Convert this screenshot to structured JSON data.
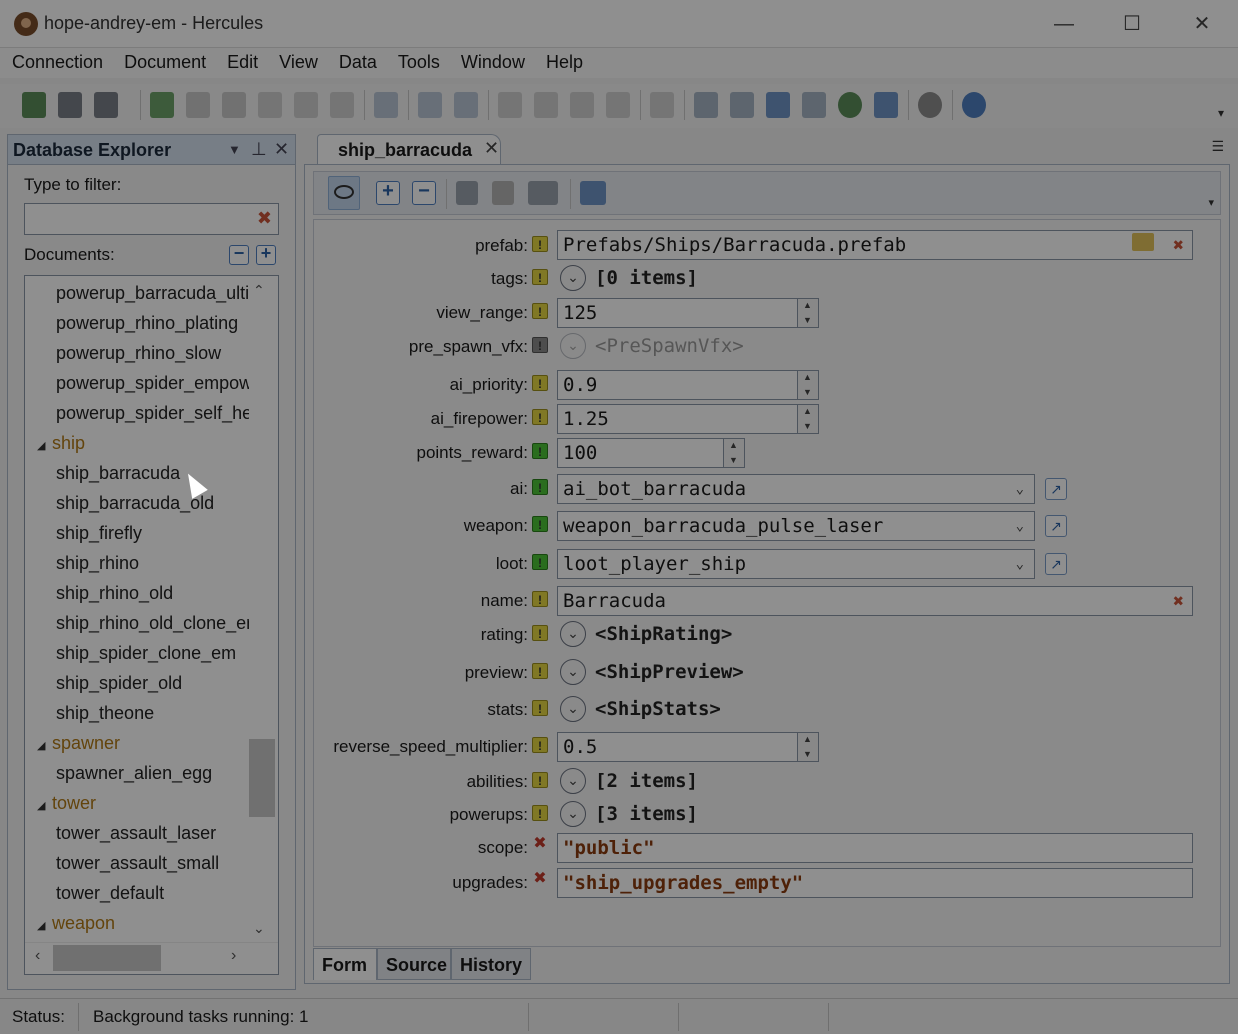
{
  "window": {
    "title": "hope-andrey-em - Hercules",
    "minimize": "—",
    "maximize": "☐",
    "close": "✕"
  },
  "menu": [
    "Connection",
    "Document",
    "Edit",
    "View",
    "Data",
    "Tools",
    "Window",
    "Help"
  ],
  "explorer": {
    "title": "Database Explorer",
    "filter_label": "Type to filter:",
    "filter_value": "",
    "documents_label": "Documents:",
    "tree": [
      {
        "type": "item",
        "label": "powerup_barracuda_ulti"
      },
      {
        "type": "item",
        "label": "powerup_rhino_plating"
      },
      {
        "type": "item",
        "label": "powerup_rhino_slow"
      },
      {
        "type": "item",
        "label": "powerup_spider_empow"
      },
      {
        "type": "item",
        "label": "powerup_spider_self_he"
      },
      {
        "type": "group",
        "label": "ship"
      },
      {
        "type": "item",
        "label": "ship_barracuda"
      },
      {
        "type": "item",
        "label": "ship_barracuda_old"
      },
      {
        "type": "item",
        "label": "ship_firefly"
      },
      {
        "type": "item",
        "label": "ship_rhino"
      },
      {
        "type": "item",
        "label": "ship_rhino_old"
      },
      {
        "type": "item",
        "label": "ship_rhino_old_clone_en"
      },
      {
        "type": "item",
        "label": "ship_spider_clone_em"
      },
      {
        "type": "item",
        "label": "ship_spider_old"
      },
      {
        "type": "item",
        "label": "ship_theone"
      },
      {
        "type": "group",
        "label": "spawner"
      },
      {
        "type": "item",
        "label": "spawner_alien_egg"
      },
      {
        "type": "group",
        "label": "tower"
      },
      {
        "type": "item",
        "label": "tower_assault_laser"
      },
      {
        "type": "item",
        "label": "tower_assault_small"
      },
      {
        "type": "item",
        "label": "tower_default"
      },
      {
        "type": "group",
        "label": "weapon"
      }
    ]
  },
  "document_tab": {
    "title": "ship_barracuda"
  },
  "form": {
    "prefab": {
      "label": "prefab:",
      "value": "Prefabs/Ships/Barracuda.prefab"
    },
    "tags": {
      "label": "tags:",
      "value": "[0 items]"
    },
    "view_range": {
      "label": "view_range:",
      "value": "125"
    },
    "pre_spawn_vfx": {
      "label": "pre_spawn_vfx:",
      "value": "<PreSpawnVfx>"
    },
    "ai_priority": {
      "label": "ai_priority:",
      "value": "0.9"
    },
    "ai_firepower": {
      "label": "ai_firepower:",
      "value": "1.25"
    },
    "points_reward": {
      "label": "points_reward:",
      "value": "100"
    },
    "ai": {
      "label": "ai:",
      "value": "ai_bot_barracuda"
    },
    "weapon": {
      "label": "weapon:",
      "value": "weapon_barracuda_pulse_laser"
    },
    "loot": {
      "label": "loot:",
      "value": "loot_player_ship"
    },
    "name": {
      "label": "name:",
      "value": "Barracuda"
    },
    "rating": {
      "label": "rating:",
      "value": "<ShipRating>"
    },
    "preview": {
      "label": "preview:",
      "value": "<ShipPreview>"
    },
    "stats": {
      "label": "stats:",
      "value": "<ShipStats>"
    },
    "reverse_speed_multiplier": {
      "label": "reverse_speed_multiplier:",
      "value": "0.5"
    },
    "abilities": {
      "label": "abilities:",
      "value": "[2 items]"
    },
    "powerups": {
      "label": "powerups:",
      "value": "[3 items]"
    },
    "scope": {
      "label": "scope:",
      "value": "\"public\""
    },
    "upgrades": {
      "label": "upgrades:",
      "value": "\"ship_upgrades_empty\""
    }
  },
  "bottom_tabs": [
    "Form",
    "Source",
    "History"
  ],
  "status": {
    "label": "Status:",
    "text": "Background tasks running: 1"
  }
}
